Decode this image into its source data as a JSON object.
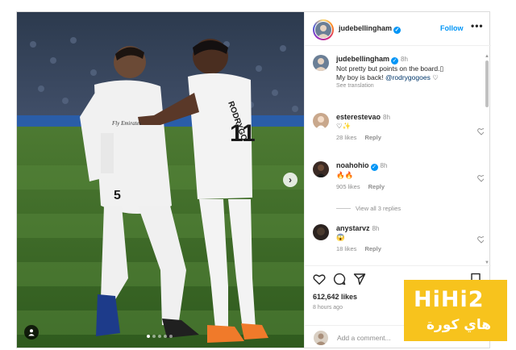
{
  "post": {
    "author": "judebellingham",
    "follow_label": "Follow",
    "more_label": "•••",
    "verified_mark": "✓",
    "caption": {
      "username": "judebellingham",
      "time": "8h",
      "line1": "Not pretty but points on the board.▯",
      "line2_prefix": "My boy is back! ",
      "mention": "@rodrygogoes",
      "see_translation": "See translation"
    },
    "comments": [
      {
        "username": "esterestevao",
        "time": "8h",
        "text": "♡✨",
        "likes": "28 likes",
        "reply": "Reply"
      },
      {
        "username": "noahohio",
        "time": "8h",
        "text": "🔥🔥",
        "likes": "905 likes",
        "reply": "Reply",
        "view_all": "View all 3 replies"
      },
      {
        "username": "anystarvz",
        "time": "8h",
        "text": "😱",
        "likes": "18 likes",
        "reply": "Reply"
      }
    ],
    "likes": "612,642 likes",
    "time_ago": "8 hours ago",
    "add_comment_placeholder": "Add a comment...",
    "carousel": {
      "count": 5,
      "active": 0
    },
    "icons": [
      "heart-icon",
      "comment-icon",
      "share-icon",
      "bookmark-icon",
      "chevron-right-icon",
      "user-tag-icon"
    ]
  },
  "photo": {
    "jersey_number_left": "5",
    "jersey_number_right": "11",
    "jersey_name_right": "RODRYGO",
    "sponsor": "Fly Emirates"
  },
  "watermark": {
    "line1": "HiHi2",
    "line2": "هاي كورة"
  },
  "colors": {
    "accent": "#0095f6",
    "watermark": "#f7c31d"
  }
}
